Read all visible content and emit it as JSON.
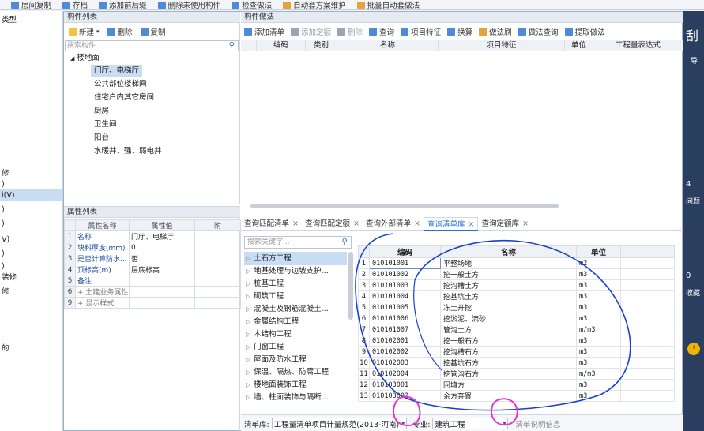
{
  "bg_toolbar": [
    "层间复制",
    "存档",
    "添加前后缀",
    "删除未使用构件",
    "检查做法",
    "自动套方案维护",
    "批量自动套做法"
  ],
  "left_strip": {
    "items": [
      "类型",
      "",
      "",
      "",
      "",
      "修",
      ")",
      "i(V)",
      ")",
      ")",
      "V)",
      ")",
      ")",
      "装修",
      "修",
      "",
      "",
      "的"
    ],
    "selected_index": 7
  },
  "right_strip": [
    "刮",
    "导",
    "4",
    "问题",
    "0",
    "收藏"
  ],
  "component_panel": {
    "title": "构件列表",
    "toolbar": {
      "new": "新建",
      "delete": "删除",
      "copy": "复制"
    },
    "search_placeholder": "搜索构件...",
    "tree_root": "楼地面",
    "tree_items": [
      "门厅、电梯厅",
      "公共部位楼梯间",
      "住宅户内其它房间",
      "厨房",
      "卫生间",
      "阳台",
      "水暖井、强、弱电井"
    ],
    "selected_index": 0
  },
  "property_panel": {
    "title": "属性列表",
    "headers": [
      "",
      "属性名称",
      "属性值",
      "附"
    ],
    "rows": [
      {
        "n": "1",
        "name": "名称",
        "value": "门厅、电梯厅"
      },
      {
        "n": "2",
        "name": "块料厚度(mm)",
        "value": "0"
      },
      {
        "n": "3",
        "name": "是否计算防水...",
        "value": "否"
      },
      {
        "n": "4",
        "name": "顶标高(m)",
        "value": "层底标高"
      },
      {
        "n": "5",
        "name": "备注",
        "value": ""
      },
      {
        "n": "6",
        "name": "+ 土建业务属性",
        "value": ""
      },
      {
        "n": "9",
        "name": "+ 显示样式",
        "value": ""
      }
    ]
  },
  "practice_panel": {
    "title": "构件做法",
    "toolbar": [
      "添加清单",
      "添加定额",
      "删除",
      "查询",
      "项目特征",
      "换算",
      "做法刷",
      "做法查询",
      "提取做法"
    ],
    "headers": [
      "",
      "编码",
      "类别",
      "名称",
      "项目特征",
      "单位",
      "工程量表达式"
    ]
  },
  "query_panel": {
    "tabs": [
      "查询匹配清单",
      "查询匹配定额",
      "查询外部清单",
      "查询清单库",
      "查询定额库"
    ],
    "active_tab": 3,
    "search_placeholder": "搜索关键字...",
    "library_items": [
      "土石方工程",
      "地基处理与边坡支护...",
      "桩基工程",
      "砌筑工程",
      "混凝土及钢筋混凝土...",
      "金属结构工程",
      "木结构工程",
      "门窗工程",
      "屋面及防水工程",
      "保温、隔热、防腐工程",
      "楼地面装饰工程",
      "墙、柱面装饰与隔断..."
    ],
    "selected_item": 0,
    "table_headers": [
      "",
      "编码",
      "名称",
      "单位"
    ],
    "rows": [
      {
        "n": "1",
        "code": "010101001",
        "name": "平整场地",
        "unit": "m2"
      },
      {
        "n": "2",
        "code": "010101002",
        "name": "挖一般土方",
        "unit": "m3"
      },
      {
        "n": "3",
        "code": "010101003",
        "name": "挖沟槽土方",
        "unit": "m3"
      },
      {
        "n": "4",
        "code": "010101004",
        "name": "挖基坑土方",
        "unit": "m3"
      },
      {
        "n": "5",
        "code": "010101005",
        "name": "冻土开挖",
        "unit": "m3"
      },
      {
        "n": "6",
        "code": "010101006",
        "name": "挖淤泥、流砂",
        "unit": "m3"
      },
      {
        "n": "7",
        "code": "010101007",
        "name": "管沟土方",
        "unit": "m/m3"
      },
      {
        "n": "8",
        "code": "010102001",
        "name": "挖一般石方",
        "unit": "m3"
      },
      {
        "n": "9",
        "code": "010102002",
        "name": "挖沟槽石方",
        "unit": "m3"
      },
      {
        "n": "10",
        "code": "010102003",
        "name": "挖基坑石方",
        "unit": "m3"
      },
      {
        "n": "11",
        "code": "010102004",
        "name": "挖管沟石方",
        "unit": "m/m3"
      },
      {
        "n": "12",
        "code": "010103001",
        "name": "回填方",
        "unit": "m3"
      },
      {
        "n": "13",
        "code": "010103002",
        "name": "余方弃置",
        "unit": "m3"
      }
    ],
    "footer": {
      "lib_label": "清单库:",
      "lib_value": "工程量清单项目计量规范(2013-河南)",
      "major_label": "专业:",
      "major_value": "建筑工程",
      "info_link": "清单说明信息"
    }
  },
  "colors": {
    "accent": "#1f6fd6",
    "selection": "#c8dcf3",
    "annotation_blue": "#1a3fd1",
    "annotation_magenta": "#e535d6"
  }
}
